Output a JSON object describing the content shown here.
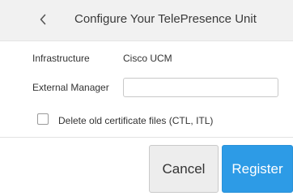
{
  "header": {
    "title": "Configure Your TelePresence Unit",
    "back_icon": "chevron-left-icon"
  },
  "form": {
    "infrastructure_label": "Infrastructure",
    "infrastructure_value": "Cisco UCM",
    "external_manager_label": "External Manager",
    "external_manager_value": "",
    "delete_certs_label": "Delete old certificate files (CTL, ITL)",
    "delete_certs_checked": false
  },
  "actions": {
    "cancel_label": "Cancel",
    "register_label": "Register"
  },
  "colors": {
    "header_bg": "#f1f1f1",
    "primary": "#2d9be6",
    "secondary_bg": "#ededed"
  }
}
